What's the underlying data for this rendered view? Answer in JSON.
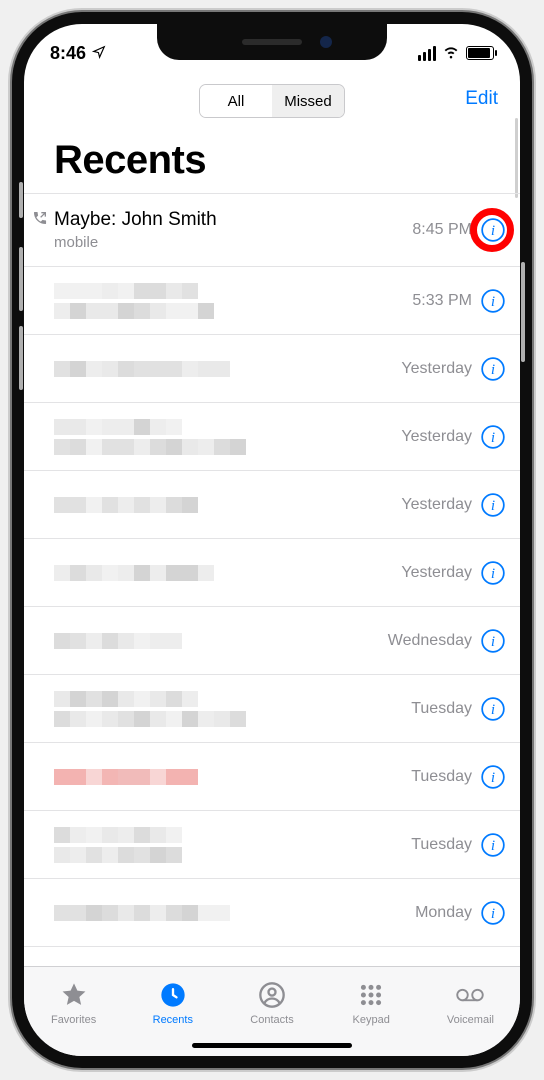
{
  "status": {
    "time": "8:46"
  },
  "topbar": {
    "seg_all": "All",
    "seg_missed": "Missed",
    "edit": "Edit"
  },
  "title": "Recents",
  "accent": "#007aff",
  "calls": [
    {
      "name": "Maybe: John Smith",
      "sub": "mobile",
      "time": "8:45 PM",
      "outgoing": true,
      "highlighted": true
    },
    {
      "time": "5:33 PM"
    },
    {
      "time": "Yesterday"
    },
    {
      "time": "Yesterday"
    },
    {
      "time": "Yesterday"
    },
    {
      "time": "Yesterday"
    },
    {
      "time": "Wednesday"
    },
    {
      "time": "Tuesday"
    },
    {
      "time": "Tuesday",
      "tint": "red"
    },
    {
      "time": "Tuesday"
    },
    {
      "time": "Monday"
    }
  ],
  "tabs": {
    "favorites": "Favorites",
    "recents": "Recents",
    "contacts": "Contacts",
    "keypad": "Keypad",
    "voicemail": "Voicemail"
  }
}
